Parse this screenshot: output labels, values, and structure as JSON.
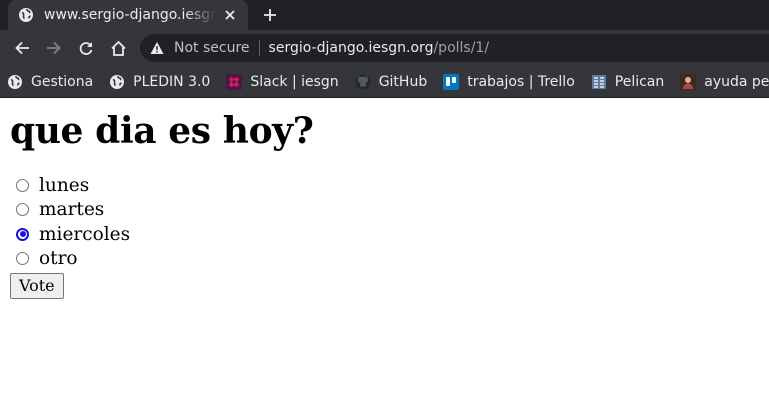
{
  "browser": {
    "tab": {
      "title": "www.sergio-django.iesgn"
    },
    "omnibox": {
      "security_label": "Not secure",
      "url_host": "sergio-django.iesgn.org",
      "url_path": "/polls/1/"
    },
    "bookmarks": [
      {
        "label": "Gestiona",
        "icon": "globe-icon"
      },
      {
        "label": "PLEDIN 3.0",
        "icon": "globe-icon"
      },
      {
        "label": "Slack | iesgn",
        "icon": "slack-icon"
      },
      {
        "label": "GitHub",
        "icon": "github-icon"
      },
      {
        "label": "trabajos | Trello",
        "icon": "trello-icon"
      },
      {
        "label": "Pelican",
        "icon": "pelican-icon"
      },
      {
        "label": "ayuda peli",
        "icon": "ayuda-icon"
      }
    ]
  },
  "poll": {
    "question": "que dia es hoy?",
    "choices": [
      {
        "label": "lunes",
        "checked": false
      },
      {
        "label": "martes",
        "checked": false
      },
      {
        "label": "miercoles",
        "checked": true
      },
      {
        "label": "otro",
        "checked": false
      }
    ],
    "vote_label": "Vote"
  },
  "colors": {
    "chrome_dark": "#202124",
    "chrome_toolbar": "#35363a",
    "radio_checked": "#1a12d9"
  }
}
